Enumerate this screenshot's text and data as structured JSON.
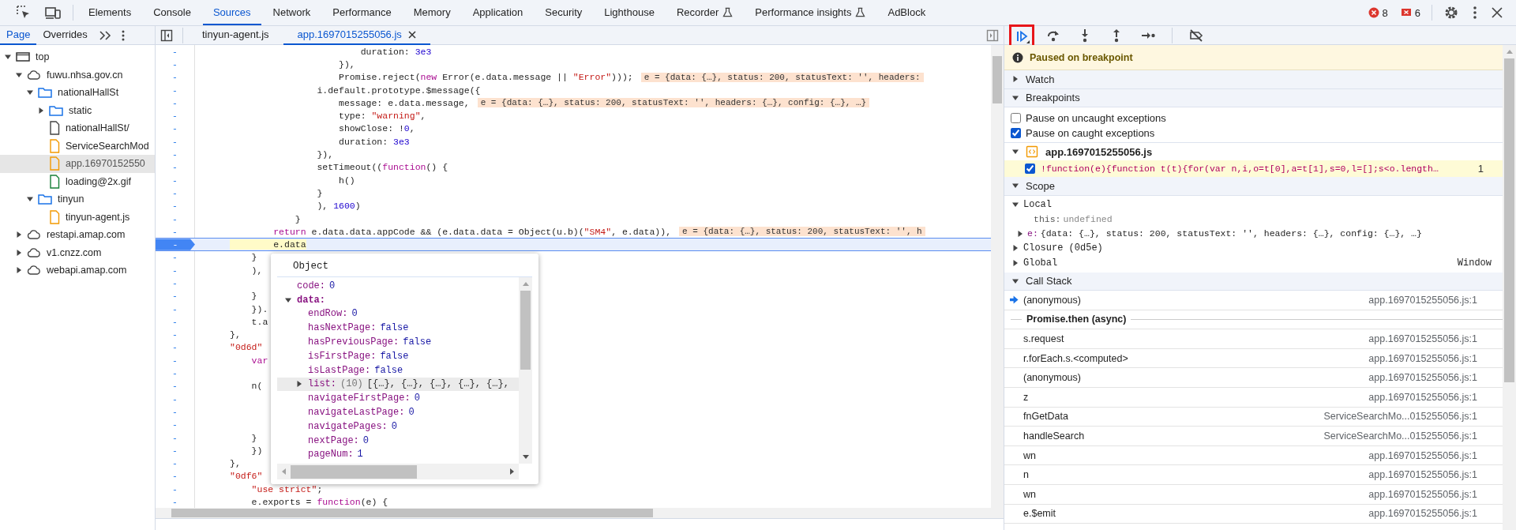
{
  "main_tabs": [
    {
      "label": "Elements",
      "selected": false,
      "experimental": false
    },
    {
      "label": "Console",
      "selected": false,
      "experimental": false
    },
    {
      "label": "Sources",
      "selected": true,
      "experimental": false
    },
    {
      "label": "Network",
      "selected": false,
      "experimental": false
    },
    {
      "label": "Performance",
      "selected": false,
      "experimental": false
    },
    {
      "label": "Memory",
      "selected": false,
      "experimental": false
    },
    {
      "label": "Application",
      "selected": false,
      "experimental": false
    },
    {
      "label": "Security",
      "selected": false,
      "experimental": false
    },
    {
      "label": "Lighthouse",
      "selected": false,
      "experimental": false
    },
    {
      "label": "Recorder",
      "selected": false,
      "experimental": true
    },
    {
      "label": "Performance insights",
      "selected": false,
      "experimental": true
    },
    {
      "label": "AdBlock",
      "selected": false,
      "experimental": false
    }
  ],
  "issues": {
    "errors": "8",
    "warnings": "6"
  },
  "navigator": {
    "tabs": [
      {
        "label": "Page",
        "selected": true
      },
      {
        "label": "Overrides",
        "selected": false
      }
    ],
    "tree": [
      {
        "label": "top",
        "kind": "frame",
        "expanded": true,
        "selected": false,
        "children": [
          {
            "label": "fuwu.nhsa.gov.cn",
            "kind": "domain",
            "expanded": true,
            "selected": false,
            "children": [
              {
                "label": "nationalHallSt",
                "kind": "folder",
                "expanded": true,
                "selected": false,
                "children": [
                  {
                    "label": "static",
                    "kind": "folder",
                    "expanded": false,
                    "selected": false
                  },
                  {
                    "label": "nationalHallSt/",
                    "kind": "document",
                    "selected": false
                  },
                  {
                    "label": "ServiceSearchMod",
                    "kind": "script",
                    "selected": false
                  },
                  {
                    "label": "app.16970152550",
                    "kind": "script",
                    "selected": true
                  },
                  {
                    "label": "loading@2x.gif",
                    "kind": "image",
                    "selected": false
                  }
                ]
              },
              {
                "label": "tinyun",
                "kind": "folder",
                "expanded": true,
                "selected": false,
                "children": [
                  {
                    "label": "tinyun-agent.js",
                    "kind": "script",
                    "selected": false
                  }
                ]
              }
            ]
          },
          {
            "label": "restapi.amap.com",
            "kind": "domain",
            "expanded": false,
            "selected": false
          },
          {
            "label": "v1.cnzz.com",
            "kind": "domain",
            "expanded": false,
            "selected": false
          },
          {
            "label": "webapi.amap.com",
            "kind": "domain",
            "expanded": false,
            "selected": false
          }
        ]
      }
    ]
  },
  "editor": {
    "tabs": [
      {
        "label": "tinyun-agent.js",
        "selected": false,
        "closable": false
      },
      {
        "label": "app.1697015255056.js",
        "selected": true,
        "closable": true
      }
    ],
    "lines": [
      {
        "num": "-",
        "code": "                        duration: 3e3",
        "current": false
      },
      {
        "num": "-",
        "code": "                    }),",
        "current": false
      },
      {
        "num": "-",
        "code": "                    Promise.reject(new Error(e.data.message || \"Error\")));",
        "value": "e = {data: {…}, status: 200, statusText: '', headers:",
        "current": false
      },
      {
        "num": "-",
        "code": "                i.default.prototype.$message({",
        "current": false
      },
      {
        "num": "-",
        "code": "                    message: e.data.message,",
        "value": "e = {data: {…}, status: 200, statusText: '', headers: {…}, config: {…}, …}",
        "current": false
      },
      {
        "num": "-",
        "code": "                    type: \"warning\",",
        "current": false
      },
      {
        "num": "-",
        "code": "                    showClose: !0,",
        "current": false
      },
      {
        "num": "-",
        "code": "                    duration: 3e3",
        "current": false
      },
      {
        "num": "-",
        "code": "                }),",
        "current": false
      },
      {
        "num": "-",
        "code": "                setTimeout((function() {",
        "current": false
      },
      {
        "num": "-",
        "code": "                    h()",
        "current": false
      },
      {
        "num": "-",
        "code": "                }",
        "current": false
      },
      {
        "num": "-",
        "code": "                ), 1600)",
        "current": false
      },
      {
        "num": "-",
        "code": "            }",
        "current": false
      },
      {
        "num": "-",
        "code": "        return e.data.data.appCode && (e.data.data = Object(u.b)(\"SM4\", e.data)),",
        "value": "e = {data: {…}, status: 200, statusText: '', h",
        "current": false
      },
      {
        "num": "-",
        "code": "        e.data",
        "current": true
      },
      {
        "num": "-",
        "code": "    }",
        "current": false
      },
      {
        "num": "-",
        "code": "    ),",
        "current": false
      },
      {
        "num": "-",
        "current": false
      },
      {
        "num": "-",
        "code": "    }",
        "current": false
      },
      {
        "num": "-",
        "code": "    }).",
        "current": false
      },
      {
        "num": "-",
        "code": "    t.a",
        "current": false
      },
      {
        "num": "-",
        "code": "},",
        "current": false
      },
      {
        "num": "-",
        "code": "\"0d6d\"",
        "current": false
      },
      {
        "num": "-",
        "code": "    var",
        "current": false
      },
      {
        "num": "-",
        "current": false
      },
      {
        "num": "-",
        "code": "    n(",
        "current": false
      },
      {
        "num": "-",
        "current": false
      },
      {
        "num": "-",
        "current": false
      },
      {
        "num": "-",
        "current": false
      },
      {
        "num": "-",
        "code": "    }",
        "current": false
      },
      {
        "num": "-",
        "code": "    })",
        "current": false
      },
      {
        "num": "-",
        "code": "},",
        "current": false
      },
      {
        "num": "-",
        "code": "\"0df6\"",
        "current": false
      },
      {
        "num": "-",
        "code": "    \"use strict\";",
        "current": false
      },
      {
        "num": "-",
        "code": "    e.exports = function(e) {",
        "current": false
      }
    ],
    "popover": {
      "title": "Object",
      "properties": [
        {
          "name": "code:",
          "value": "0",
          "kind": "number"
        },
        {
          "name": "data:",
          "kind": "object",
          "expanded": true,
          "children": [
            {
              "name": "endRow:",
              "value": "0",
              "kind": "number"
            },
            {
              "name": "hasNextPage:",
              "value": "false",
              "kind": "boolean"
            },
            {
              "name": "hasPreviousPage:",
              "value": "false",
              "kind": "boolean"
            },
            {
              "name": "isFirstPage:",
              "value": "false",
              "kind": "boolean"
            },
            {
              "name": "isLastPage:",
              "value": "false",
              "kind": "boolean"
            },
            {
              "name": "list:",
              "count": "(10)",
              "value": "[{…}, {…}, {…}, {…}, {…},",
              "kind": "array",
              "expanded": false,
              "hovered": true
            },
            {
              "name": "navigateFirstPage:",
              "value": "0",
              "kind": "number"
            },
            {
              "name": "navigateLastPage:",
              "value": "0",
              "kind": "number"
            },
            {
              "name": "navigatePages:",
              "value": "0",
              "kind": "number"
            },
            {
              "name": "nextPage:",
              "value": "0",
              "kind": "number"
            },
            {
              "name": "pageNum:",
              "value": "1",
              "kind": "number"
            }
          ]
        }
      ]
    }
  },
  "debugger": {
    "controls": [
      {
        "kind": "resume",
        "highlighted": true
      },
      {
        "kind": "step_over",
        "highlighted": false
      },
      {
        "kind": "step_into",
        "highlighted": false
      },
      {
        "kind": "step_out",
        "highlighted": false
      },
      {
        "kind": "step",
        "highlighted": false
      },
      {
        "kind": "deactivate",
        "highlighted": false
      }
    ],
    "paused": "Paused on breakpoint",
    "watch": {
      "label": "Watch",
      "expanded": false
    },
    "breakpoints": {
      "label": "Breakpoints",
      "expanded": true,
      "options": [
        {
          "label": "Pause on uncaught exceptions",
          "checked": false
        },
        {
          "label": "Pause on caught exceptions",
          "checked": true
        }
      ],
      "files": [
        {
          "name": "app.1697015255056.js",
          "expanded": true,
          "breakpoints": [
            {
              "code": "!function(e){function t(t){for(var n,i,o=t[0],a=t[1],s=0,l=[];s<o.length…",
              "line": "1",
              "checked": true
            }
          ]
        }
      ]
    },
    "scope": {
      "label": "Scope",
      "expanded": true,
      "scopes": [
        {
          "label": "Local",
          "expanded": true,
          "vars": [
            {
              "name": "this:",
              "value": "undefined",
              "expandable": false
            },
            {
              "name": "e:",
              "value": "{data: {…}, status: 200, statusText: '', headers: {…}, config: {…}, …}",
              "expandable": true
            }
          ]
        },
        {
          "label": "Closure (0d5e)",
          "expanded": false
        },
        {
          "label": "Global",
          "expanded": false,
          "value": "Window"
        }
      ]
    },
    "call_stack": {
      "label": "Call Stack",
      "expanded": true,
      "frames": [
        {
          "kind": "frame",
          "name": "(anonymous)",
          "location": "app.1697015255056.js:1",
          "current": true
        },
        {
          "kind": "async",
          "name": "Promise.then (async)"
        },
        {
          "kind": "frame",
          "name": "s.request",
          "location": "app.1697015255056.js:1",
          "current": false
        },
        {
          "kind": "frame",
          "name": "r.forEach.s.<computed>",
          "location": "app.1697015255056.js:1",
          "current": false
        },
        {
          "kind": "frame",
          "name": "(anonymous)",
          "location": "app.1697015255056.js:1",
          "current": false
        },
        {
          "kind": "frame",
          "name": "z",
          "location": "app.1697015255056.js:1",
          "current": false
        },
        {
          "kind": "frame",
          "name": "fnGetData",
          "location": "ServiceSearchMo...015255056.js:1",
          "current": false
        },
        {
          "kind": "frame",
          "name": "handleSearch",
          "location": "ServiceSearchMo...015255056.js:1",
          "current": false
        },
        {
          "kind": "frame",
          "name": "wn",
          "location": "app.1697015255056.js:1",
          "current": false
        },
        {
          "kind": "frame",
          "name": "n",
          "location": "app.1697015255056.js:1",
          "current": false
        },
        {
          "kind": "frame",
          "name": "wn",
          "location": "app.1697015255056.js:1",
          "current": false
        },
        {
          "kind": "frame",
          "name": "e.$emit",
          "location": "app.1697015255056.js:1",
          "current": false
        }
      ]
    }
  }
}
